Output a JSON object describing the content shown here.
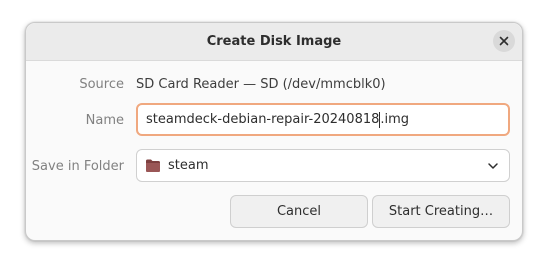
{
  "dialog": {
    "title": "Create Disk Image",
    "close_icon": "close-icon"
  },
  "form": {
    "source": {
      "label": "Source",
      "value": "SD Card Reader — SD (/dev/mmcblk0)"
    },
    "name": {
      "label": "Name",
      "value_before_cursor": "steamdeck-debian-repair-20240818",
      "value_after_cursor": ".img"
    },
    "folder": {
      "label": "Save in Folder",
      "value": "steam",
      "icon": "folder-icon",
      "dropdown_icon": "chevron-down-icon"
    }
  },
  "buttons": {
    "cancel": "Cancel",
    "start": "Start Creating…"
  },
  "colors": {
    "focus_border": "#f0a87f",
    "folder_icon": "#8c4a4a"
  }
}
